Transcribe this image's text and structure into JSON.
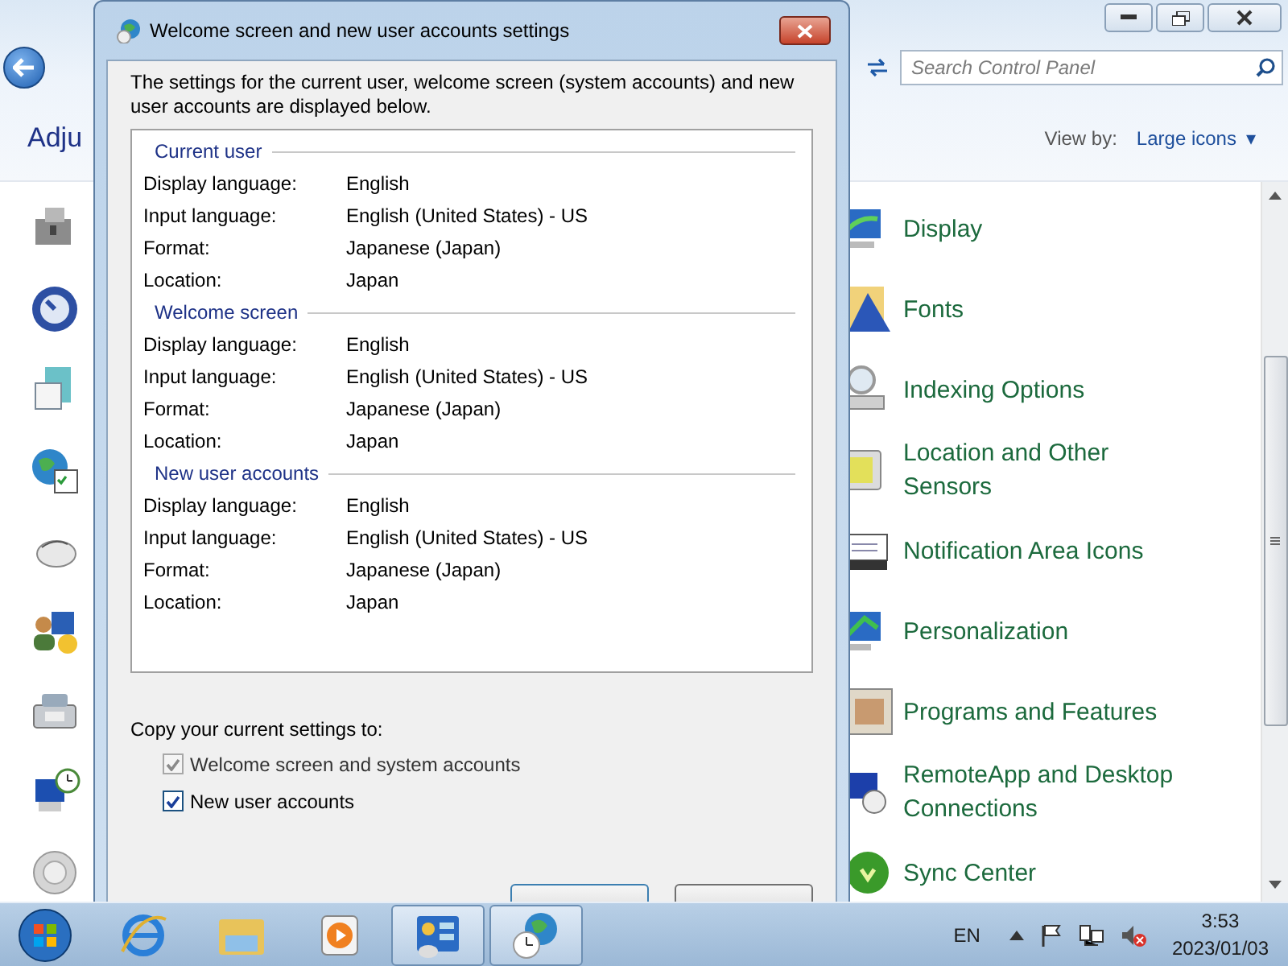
{
  "control_panel": {
    "search": {
      "placeholder": "Search Control Panel"
    },
    "heading": "Adju",
    "view_by": {
      "label": "View by:",
      "value": "Large icons",
      "caret": "▾"
    },
    "items": [
      {
        "label": "Display"
      },
      {
        "label": "Fonts"
      },
      {
        "label": "Indexing Options"
      },
      {
        "label": "Location and Other Sensors"
      },
      {
        "label": "Notification Area Icons"
      },
      {
        "label": "Personalization"
      },
      {
        "label": "Programs and Features"
      },
      {
        "label": "RemoteApp and Desktop Connections"
      },
      {
        "label": "Sync Center"
      }
    ]
  },
  "dialog": {
    "title": "Welcome screen and new user accounts settings",
    "intro": "The settings for the current user, welcome screen (system accounts) and new user accounts are displayed below.",
    "sections": [
      {
        "title": "Current user",
        "rows": [
          {
            "label": "Display language:",
            "value": "English"
          },
          {
            "label": "Input language:",
            "value": "English (United States) - US"
          },
          {
            "label": "Format:",
            "value": "Japanese (Japan)"
          },
          {
            "label": "Location:",
            "value": "Japan"
          }
        ]
      },
      {
        "title": "Welcome screen",
        "rows": [
          {
            "label": "Display language:",
            "value": "English"
          },
          {
            "label": "Input language:",
            "value": "English (United States) - US"
          },
          {
            "label": "Format:",
            "value": "Japanese (Japan)"
          },
          {
            "label": "Location:",
            "value": "Japan"
          }
        ]
      },
      {
        "title": "New user accounts",
        "rows": [
          {
            "label": "Display language:",
            "value": "English"
          },
          {
            "label": "Input language:",
            "value": "English (United States) - US"
          },
          {
            "label": "Format:",
            "value": "Japanese (Japan)"
          },
          {
            "label": "Location:",
            "value": "Japan"
          }
        ]
      }
    ],
    "copy_label": "Copy your current settings to:",
    "options": [
      {
        "label": "Welcome screen and system accounts",
        "checked": true,
        "disabled": true
      },
      {
        "label": "New user accounts",
        "checked": true,
        "disabled": false
      }
    ]
  },
  "taskbar": {
    "apps": [
      {
        "selected": false
      },
      {
        "selected": false
      },
      {
        "selected": false
      },
      {
        "selected": true
      },
      {
        "selected": true
      }
    ],
    "language": "EN",
    "time": "3:53",
    "date": "2023/01/03"
  }
}
